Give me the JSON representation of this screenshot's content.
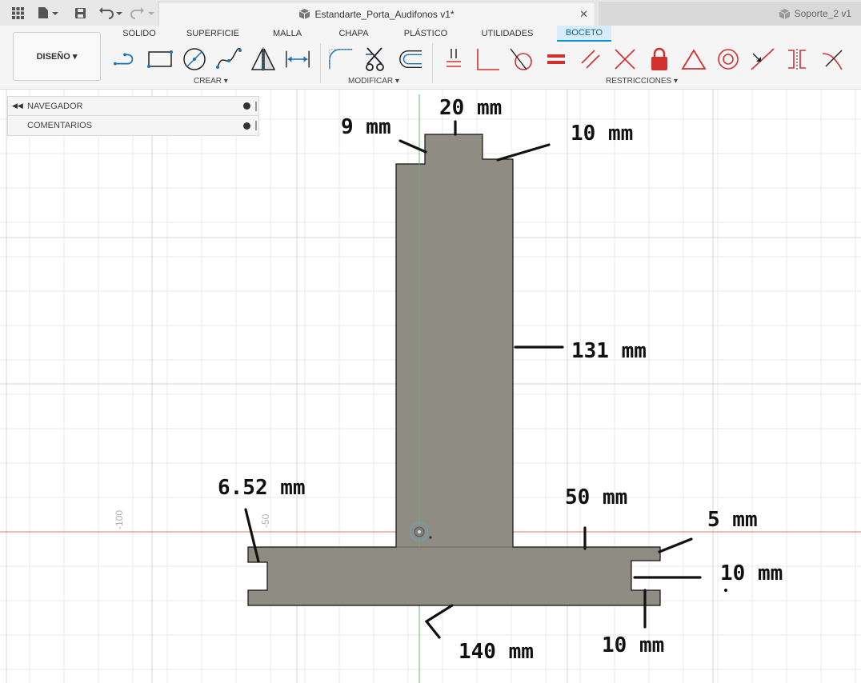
{
  "titlebar": {
    "tabs": [
      {
        "label": "Estandarte_Porta_Audifonos v1*",
        "active": true
      },
      {
        "label": "Soporte_2 v1",
        "active": false
      }
    ],
    "close_glyph": "✕"
  },
  "toolbar": {
    "workspace_label": "DISEÑO ▾",
    "ribbon_tabs": [
      "SOLIDO",
      "SUPERFICIE",
      "MALLA",
      "CHAPA",
      "PLÁSTICO",
      "UTILIDADES",
      "BOCETO"
    ],
    "active_tab": "BOCETO",
    "groups": {
      "create": "CREAR ▾",
      "modify": "MODIFICAR ▾",
      "constraints": "RESTRICCIONES ▾"
    },
    "accent_color": "#0696d7",
    "constraint_color": "#d32f2f"
  },
  "browser": {
    "rows": [
      "NAVEGADOR",
      "COMENTARIOS"
    ]
  },
  "canvas": {
    "axis_labels": [
      "-100",
      "-50"
    ],
    "sketch_fill": "#8f8c84"
  },
  "annotations": {
    "top_width": "20 mm",
    "left_step": "9 mm",
    "right_step": "10 mm",
    "stem_height": "131 mm",
    "left_notch": "6.52 mm",
    "base_right": "50 mm",
    "notch_top": "5 mm",
    "notch_depth": "10 mm",
    "notch_height": "10 mm",
    "base_width": "140 mm"
  }
}
